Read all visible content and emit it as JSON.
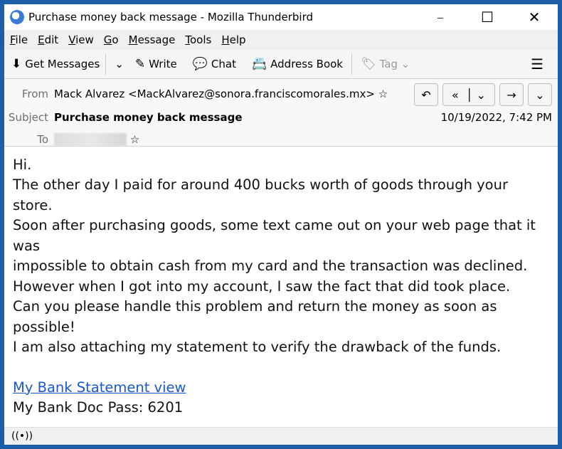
{
  "window": {
    "title": "Purchase money back message - Mozilla Thunderbird",
    "minimize": "–",
    "maximize": "☐",
    "close": "✕"
  },
  "menu": [
    "File",
    "Edit",
    "View",
    "Go",
    "Message",
    "Tools",
    "Help"
  ],
  "toolbar": {
    "get_messages": "Get Messages",
    "write": "Write",
    "chat": "Chat",
    "address_book": "Address Book",
    "tag": "Tag"
  },
  "header": {
    "from_label": "From",
    "from_value": "Mack Alvarez <MackAlvarez@sonora.franciscomorales.mx>",
    "subject_label": "Subject",
    "subject_value": "Purchase money back message",
    "to_label": "To",
    "date": "10/19/2022, 7:42 PM"
  },
  "body": {
    "lines": [
      "Hi.",
      "The other day I paid for around 400 bucks worth of goods through your store.",
      "Soon after purchasing goods, some text came out on your web page that it was",
      "impossible to obtain cash from my card and the transaction was declined.",
      "However when I got into my account, I saw the fact that did took place.",
      "Can you please handle this problem and return the money as soon as possible!",
      "I am also attaching my statement to verify the drawback of the funds."
    ],
    "link": "My Bank Statement view",
    "pass": "My Bank Doc Pass: 6201"
  },
  "colors": {
    "border": "#1c5ea8",
    "link": "#1a57d3"
  }
}
